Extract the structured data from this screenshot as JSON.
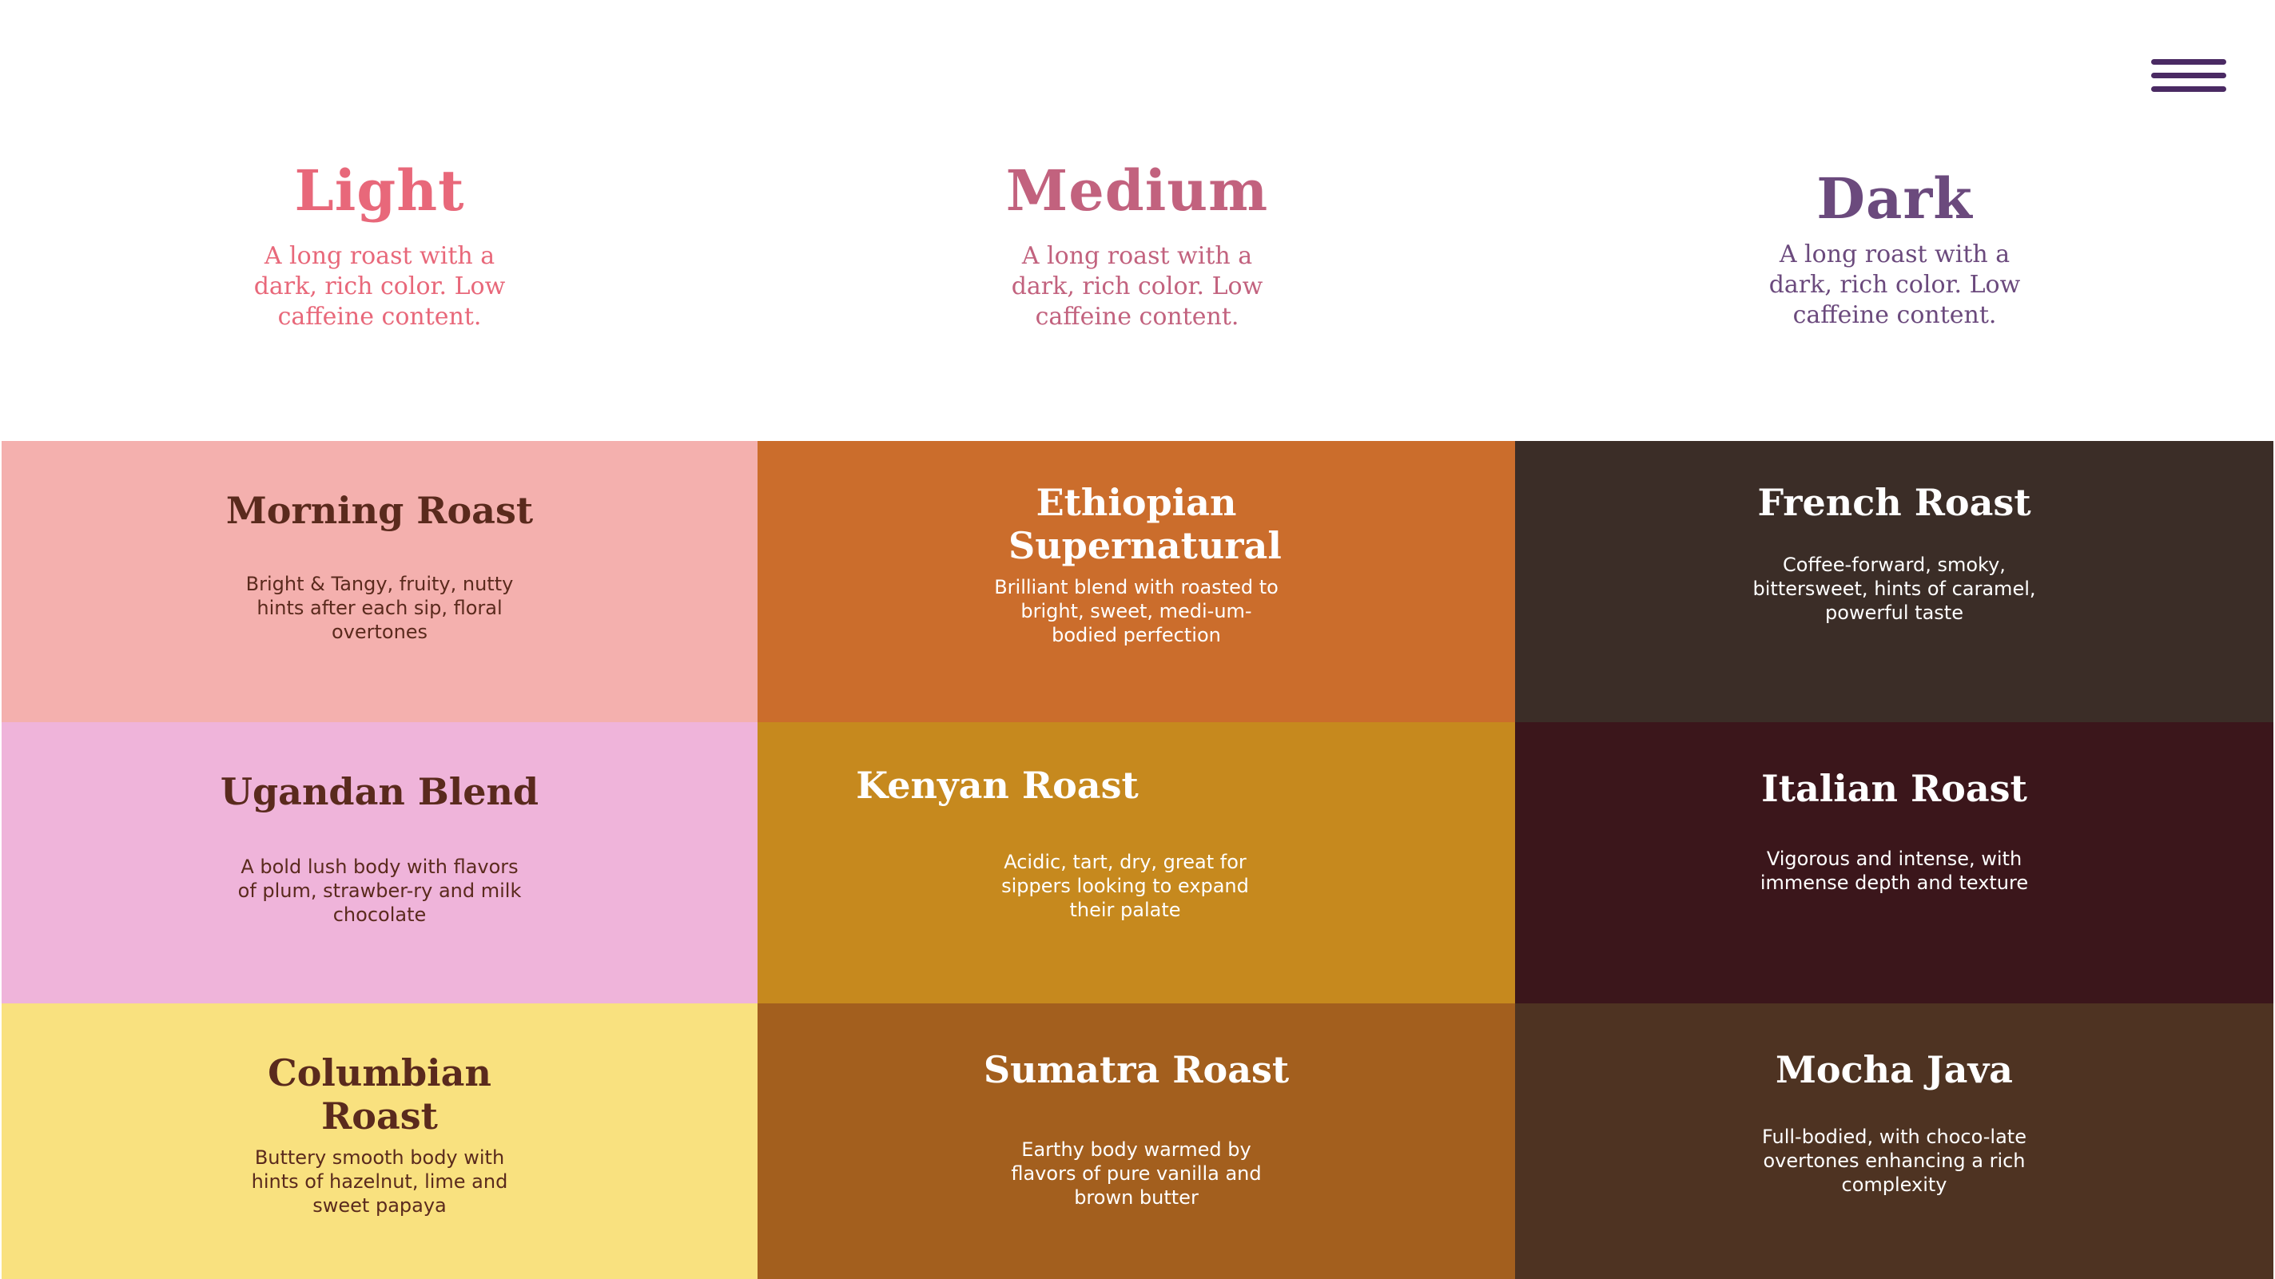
{
  "menu": {
    "icon": "hamburger-menu-icon",
    "color": "#4a2a63"
  },
  "roast_levels": [
    {
      "title": "Light",
      "description": "A long roast with a dark, rich color. Low caffeine content.",
      "color": "#e8687a"
    },
    {
      "title": "Medium",
      "description": "A long roast with a dark, rich color. Low caffeine content.",
      "color": "#c2627e"
    },
    {
      "title": "Dark",
      "description": "A long roast with a dark, rich color. Low caffeine content.",
      "color": "#6b4a7d"
    }
  ],
  "coffees": [
    {
      "name": "Morning Roast",
      "description": "Bright & Tangy, fruity, nutty hints after each sip, floral overtones",
      "bg": "#f4b0ae"
    },
    {
      "name": "Ethiopian Supernatural",
      "description": "Brilliant blend with roasted to bright, sweet, medi-um-bodied perfection",
      "bg": "#cb6d2c"
    },
    {
      "name": "French Roast",
      "description": "Coffee-forward, smoky, bittersweet, hints of caramel, powerful taste",
      "bg": "#3b2d27"
    },
    {
      "name": "Ugandan Blend",
      "description": "A bold lush body with flavors of plum, strawber-ry and milk chocolate",
      "bg": "#efb4da"
    },
    {
      "name": "Kenyan Roast",
      "description": "Acidic, tart, dry, great for sippers looking to expand their palate",
      "bg": "#c6891e"
    },
    {
      "name": "Italian Roast",
      "description": "Vigorous and intense, with immense depth and texture",
      "bg": "#3b161b"
    },
    {
      "name": "Columbian Roast",
      "description": "Buttery smooth body with hints of hazelnut, lime and sweet papaya",
      "bg": "#f9e17f"
    },
    {
      "name": "Sumatra Roast",
      "description": "Earthy body warmed by flavors of pure vanilla and brown butter",
      "bg": "#a35f1e"
    },
    {
      "name": "Mocha Java",
      "description": "Full-bodied, with  choco-late overtones enhancing a rich complexity",
      "bg": "#4e3322"
    }
  ]
}
